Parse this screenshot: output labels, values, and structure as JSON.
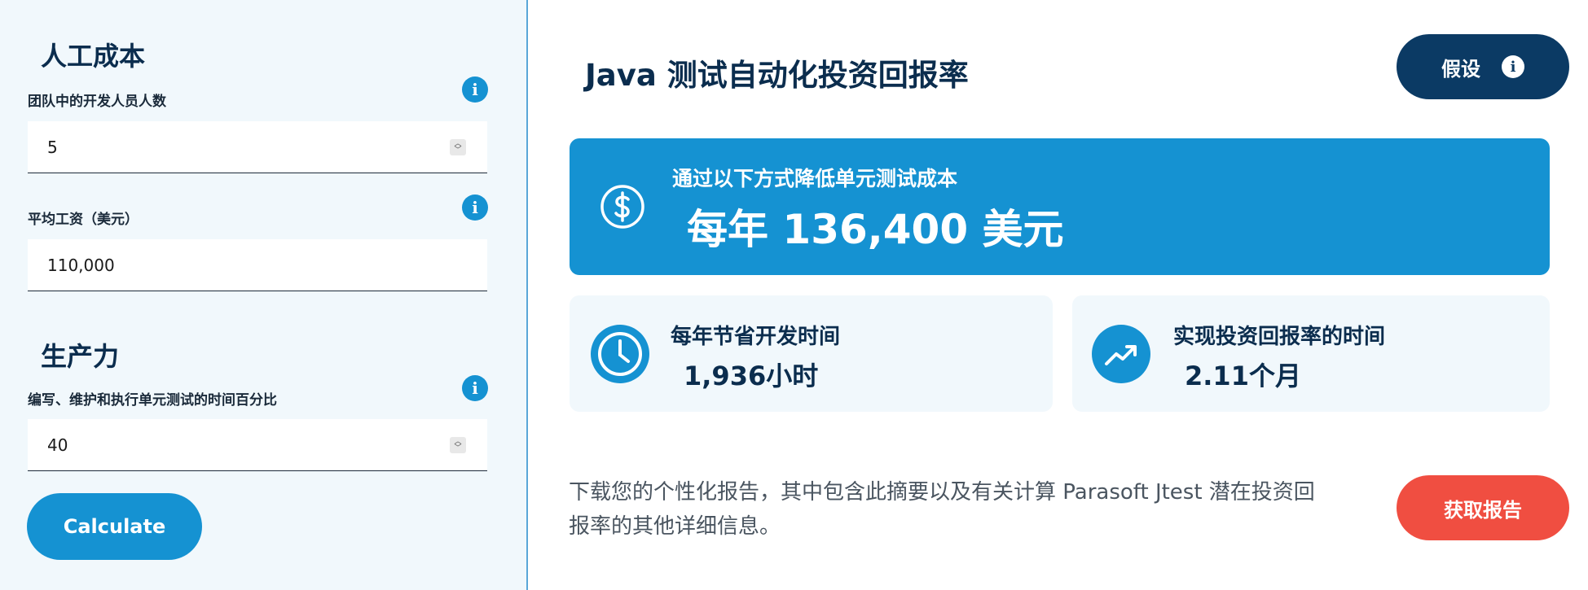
{
  "sidebar": {
    "labor_cost": {
      "title": "人工成本",
      "team_size": {
        "label": "团队中的开发人员人数",
        "value": "5"
      },
      "salary": {
        "label": "平均工资（美元）",
        "value": "110,000"
      }
    },
    "productivity": {
      "title": "生产力",
      "test_time": {
        "label": "编写、维护和执行单元测试的时间百分比",
        "value": "40"
      }
    },
    "info_glyph": "i",
    "calculate_label": "Calculate"
  },
  "main": {
    "title": "Java 测试自动化投资回报率",
    "assumptions_label": "假设",
    "assumptions_icon": "info-icon",
    "savings": {
      "label": "通过以下方式降低单元测试成本",
      "value": "每年 136,400 美元",
      "icon": "dollar-icon"
    },
    "stats": [
      {
        "label": "每年节省开发时间",
        "value": "1,936小时",
        "icon": "clock-icon"
      },
      {
        "label": "实现投资回报率的时间",
        "value": "2.11个月",
        "icon": "trend-up-icon"
      }
    ],
    "report": {
      "text": "下载您的个性化报告，其中包含此摘要以及有关计算 Parasoft Jtest 潜在投资回报率的其他详细信息。",
      "button_label": "获取报告"
    }
  },
  "colors": {
    "primary_blue": "#1592d2",
    "navy": "#0b3a64",
    "coral": "#f04e41",
    "panel_bg": "#f1f8fc"
  }
}
